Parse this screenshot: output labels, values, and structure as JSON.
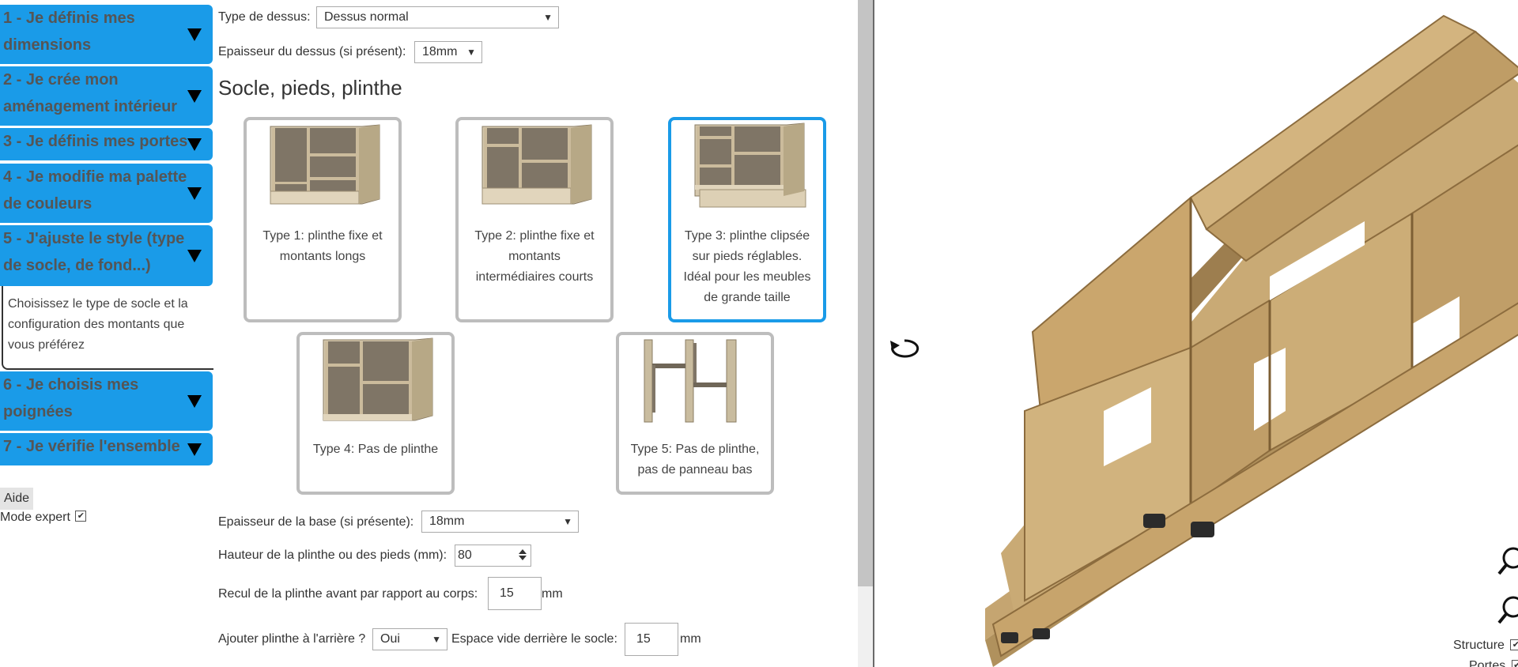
{
  "steps": [
    {
      "label": "1 - Je définis mes dimensions"
    },
    {
      "label": "2 - Je crée mon aménagement intérieur"
    },
    {
      "label": "3 - Je définis mes portes"
    },
    {
      "label": "4 - Je modifie ma palette de couleurs"
    },
    {
      "label": "5 - J'ajuste le style (type de socle, de fond...)"
    },
    {
      "label": "6 - Je choisis mes poignées"
    },
    {
      "label": "7 - Je vérifie l'ensemble"
    }
  ],
  "step5_help": "Choisissez le type de socle et la configuration des montants que vous préférez",
  "aide_label": "Aide",
  "mode_expert_label": "Mode expert",
  "mode_expert_checked": "✔",
  "form": {
    "type_dessus_label": "Type de dessus:",
    "type_dessus_value": "Dessus normal",
    "epaisseur_dessus_label": "Epaisseur du dessus (si présent):",
    "epaisseur_dessus_value": "18mm",
    "section_title": "Socle, pieds, plinthe",
    "socle_types": [
      {
        "caption": "Type 1: plinthe fixe et montants longs",
        "selected": false
      },
      {
        "caption": "Type 2: plinthe fixe et montants intermédiaires courts",
        "selected": false
      },
      {
        "caption": "Type 3: plinthe clipsée sur pieds réglables. Idéal pour les meubles de grande taille",
        "selected": true
      },
      {
        "caption": "Type 4: Pas de plinthe",
        "selected": false
      },
      {
        "caption": "Type 5: Pas de plinthe, pas de panneau bas",
        "selected": false
      }
    ],
    "epaisseur_base_label": "Epaisseur de la base (si présente):",
    "epaisseur_base_value": "18mm",
    "hauteur_plinthe_label": "Hauteur de la plinthe ou des pieds (mm):",
    "hauteur_plinthe_value": "80",
    "recul_label": "Recul de la plinthe avant par rapport au corps:",
    "recul_value": "15",
    "recul_unit": "mm",
    "plinthe_arriere_label": "Ajouter plinthe à l'arrière ?",
    "plinthe_arriere_value": "Oui",
    "espace_vide_label": "Espace vide derrière le socle:",
    "espace_vide_value": "15",
    "espace_vide_unit": "mm"
  },
  "viewer": {
    "structure_label": "Structure",
    "portes_label": "Portes",
    "checked": "✔"
  },
  "colors": {
    "accent": "#1a9be8",
    "wood": "#b89a68",
    "card_border": "#bdbdbd"
  }
}
